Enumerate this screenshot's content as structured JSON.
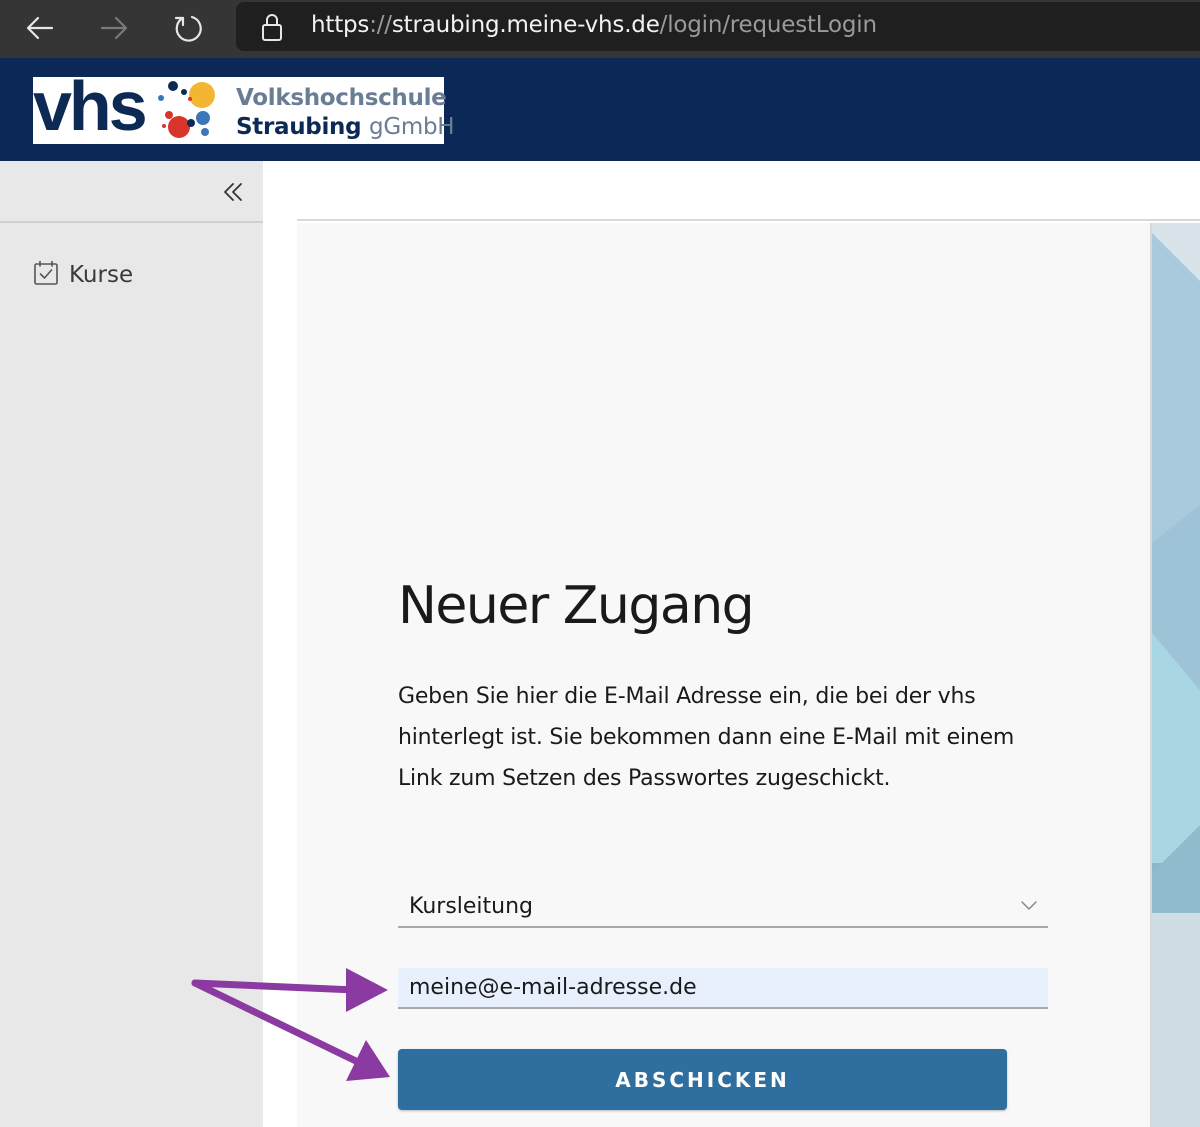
{
  "browser": {
    "url_scheme": "https",
    "url_sep": "://",
    "url_host": "straubing.meine-vhs.de",
    "url_path": "/login/requestLogin",
    "icons": [
      "back-arrow-icon",
      "forward-arrow-icon",
      "reload-icon",
      "lock-icon"
    ]
  },
  "header": {
    "logo_mark": "vhs",
    "logo_line1": "Volkshochschule",
    "logo_line2_bold": "Straubing",
    "logo_line2_light": "gGmbH"
  },
  "sidebar": {
    "collapse_icon": "double-chevron-left-icon",
    "items": [
      {
        "label": "Kurse",
        "icon": "calendar-check-icon"
      }
    ]
  },
  "main": {
    "title": "Neuer Zugang",
    "intro": "Geben Sie hier die E-Mail Adresse ein, die bei der vhs hinterlegt ist. Sie bekommen dann eine E-Mail mit einem Link zum Setzen des Passwortes zugeschickt.",
    "role_select": {
      "value": "Kursleitung",
      "icon": "chevron-down-icon"
    },
    "email_input": {
      "value": "meine@e-mail-adresse.de"
    },
    "submit_label": "ABSCHICKEN"
  },
  "colors": {
    "header_bg": "#0b2857",
    "button_bg": "#2e6f9f",
    "annotation_arrow": "#8a3aa0",
    "autofill_bg": "#e8f0fe"
  }
}
